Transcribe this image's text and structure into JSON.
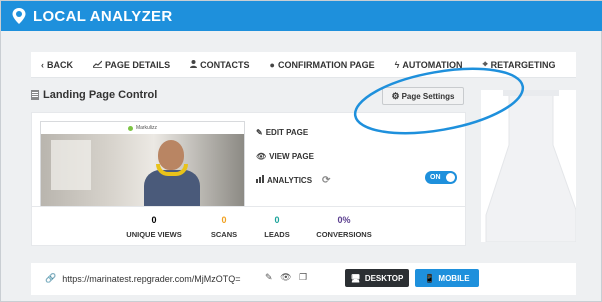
{
  "app": {
    "brand": "LOCAL ANALYZER",
    "brand_color": "#1e90dc"
  },
  "tabs": [
    {
      "icon": "chevron-left-icon",
      "glyph": "‹",
      "label": "BACK"
    },
    {
      "icon": "chart-icon",
      "glyph": "📈",
      "label": "PAGE DETAILS"
    },
    {
      "icon": "user-icon",
      "glyph": "👤",
      "label": "CONTACTS"
    },
    {
      "icon": "circle-icon",
      "glyph": "●",
      "label": "CONFIRMATION PAGE"
    },
    {
      "icon": "bolt-icon",
      "glyph": "ϟ",
      "label": "AUTOMATION"
    },
    {
      "icon": "crosshair-icon",
      "glyph": "⌖",
      "label": "RETARGETING"
    }
  ],
  "section": {
    "title": "Landing Page Control"
  },
  "settings_button": {
    "label": "Page Settings"
  },
  "preview": {
    "site_name": "Markulizz"
  },
  "actions": {
    "edit": "EDIT PAGE",
    "view": "VIEW PAGE",
    "analytics": "ANALYTICS",
    "toggle": "ON"
  },
  "stats": [
    {
      "value": "0",
      "label": "UNIQUE VIEWS",
      "color": "#333333"
    },
    {
      "value": "0",
      "label": "SCANS",
      "color": "#f0a020"
    },
    {
      "value": "0",
      "label": "LEADS",
      "color": "#1aa39a"
    },
    {
      "value": "0%",
      "label": "CONVERSIONS",
      "color": "#5b3f8f"
    }
  ],
  "url": {
    "value": "https://marinatest.repgrader.com/MjMzOTQ=",
    "desktop": "DESKTOP",
    "mobile": "MOBILE"
  }
}
